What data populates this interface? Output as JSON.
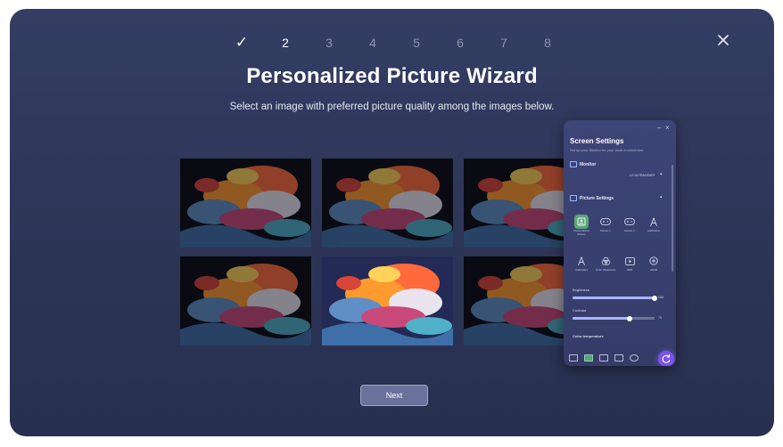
{
  "wizard": {
    "steps": [
      "✓",
      "2",
      "3",
      "4",
      "5",
      "6",
      "7",
      "8"
    ],
    "current_step": 2,
    "title": "Personalized Picture Wizard",
    "subtitle": "Select an image with preferred picture quality among the images below.",
    "next_label": "Next",
    "selected_image_index": 4,
    "image_count": 6
  },
  "panel": {
    "title": "Screen Settings",
    "subtitle": "Set up your Monitor for your work environment",
    "monitor_section": "Monitor",
    "monitor_selected": "LG ULTRAGEAR+",
    "picture_section": "Picture Settings",
    "modes": [
      {
        "label": "Personalized Picture",
        "icon": "person-image-icon",
        "selected": true
      },
      {
        "label": "Gamer 1",
        "icon": "gamepad-icon",
        "selected": false
      },
      {
        "label": "Gamer 2",
        "icon": "gamepad-icon",
        "selected": false
      },
      {
        "label": "Calibration",
        "icon": "compass-icon",
        "selected": false
      },
      {
        "label": "Calibrated",
        "icon": "compass-icon",
        "selected": false
      },
      {
        "label": "Color Weakness",
        "icon": "color-circles-icon",
        "selected": false
      },
      {
        "label": "HDR",
        "icon": "play-icon",
        "selected": false
      },
      {
        "label": "sRGB",
        "icon": "plus-circle-icon",
        "selected": false
      }
    ],
    "brightness_label": "Brightness",
    "brightness_value": "100",
    "brightness_level": 1.0,
    "contrast_label": "Contrast",
    "contrast_value": "70",
    "contrast_level": 0.7,
    "color_temp_label": "Color temperature"
  },
  "colors": {
    "background": "#2e3659",
    "accent": "#7a54e8",
    "selected": "#5aa47a"
  }
}
